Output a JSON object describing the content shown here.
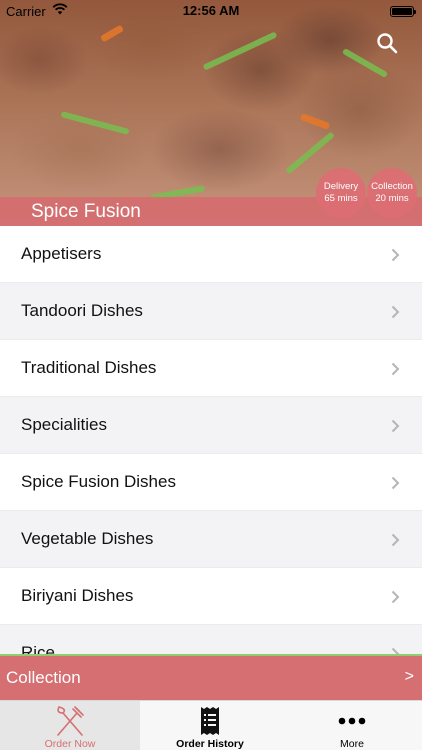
{
  "status_bar": {
    "carrier": "Carrier",
    "time": "12:56 AM"
  },
  "header": {
    "restaurant_name": "Spice Fusion",
    "delivery": {
      "label": "Delivery",
      "time": "65 mins"
    },
    "collection": {
      "label": "Collection",
      "time": "20 mins"
    }
  },
  "menu": {
    "items": [
      {
        "label": "Appetisers"
      },
      {
        "label": "Tandoori Dishes"
      },
      {
        "label": "Traditional Dishes"
      },
      {
        "label": "Specialities"
      },
      {
        "label": "Spice Fusion Dishes"
      },
      {
        "label": "Vegetable Dishes"
      },
      {
        "label": "Biriyani Dishes"
      },
      {
        "label": "Rice"
      }
    ]
  },
  "order_mode": {
    "label": "Collection",
    "arrow": ">"
  },
  "tabs": [
    {
      "label": "Order Now",
      "icon": "fork-knife-icon",
      "active": true
    },
    {
      "label": "Order History",
      "icon": "receipt-icon",
      "active": false
    },
    {
      "label": "More",
      "icon": "more-dots-icon",
      "active": false
    }
  ],
  "colors": {
    "accent": "#d56f71",
    "accent_green": "#8fce70"
  }
}
